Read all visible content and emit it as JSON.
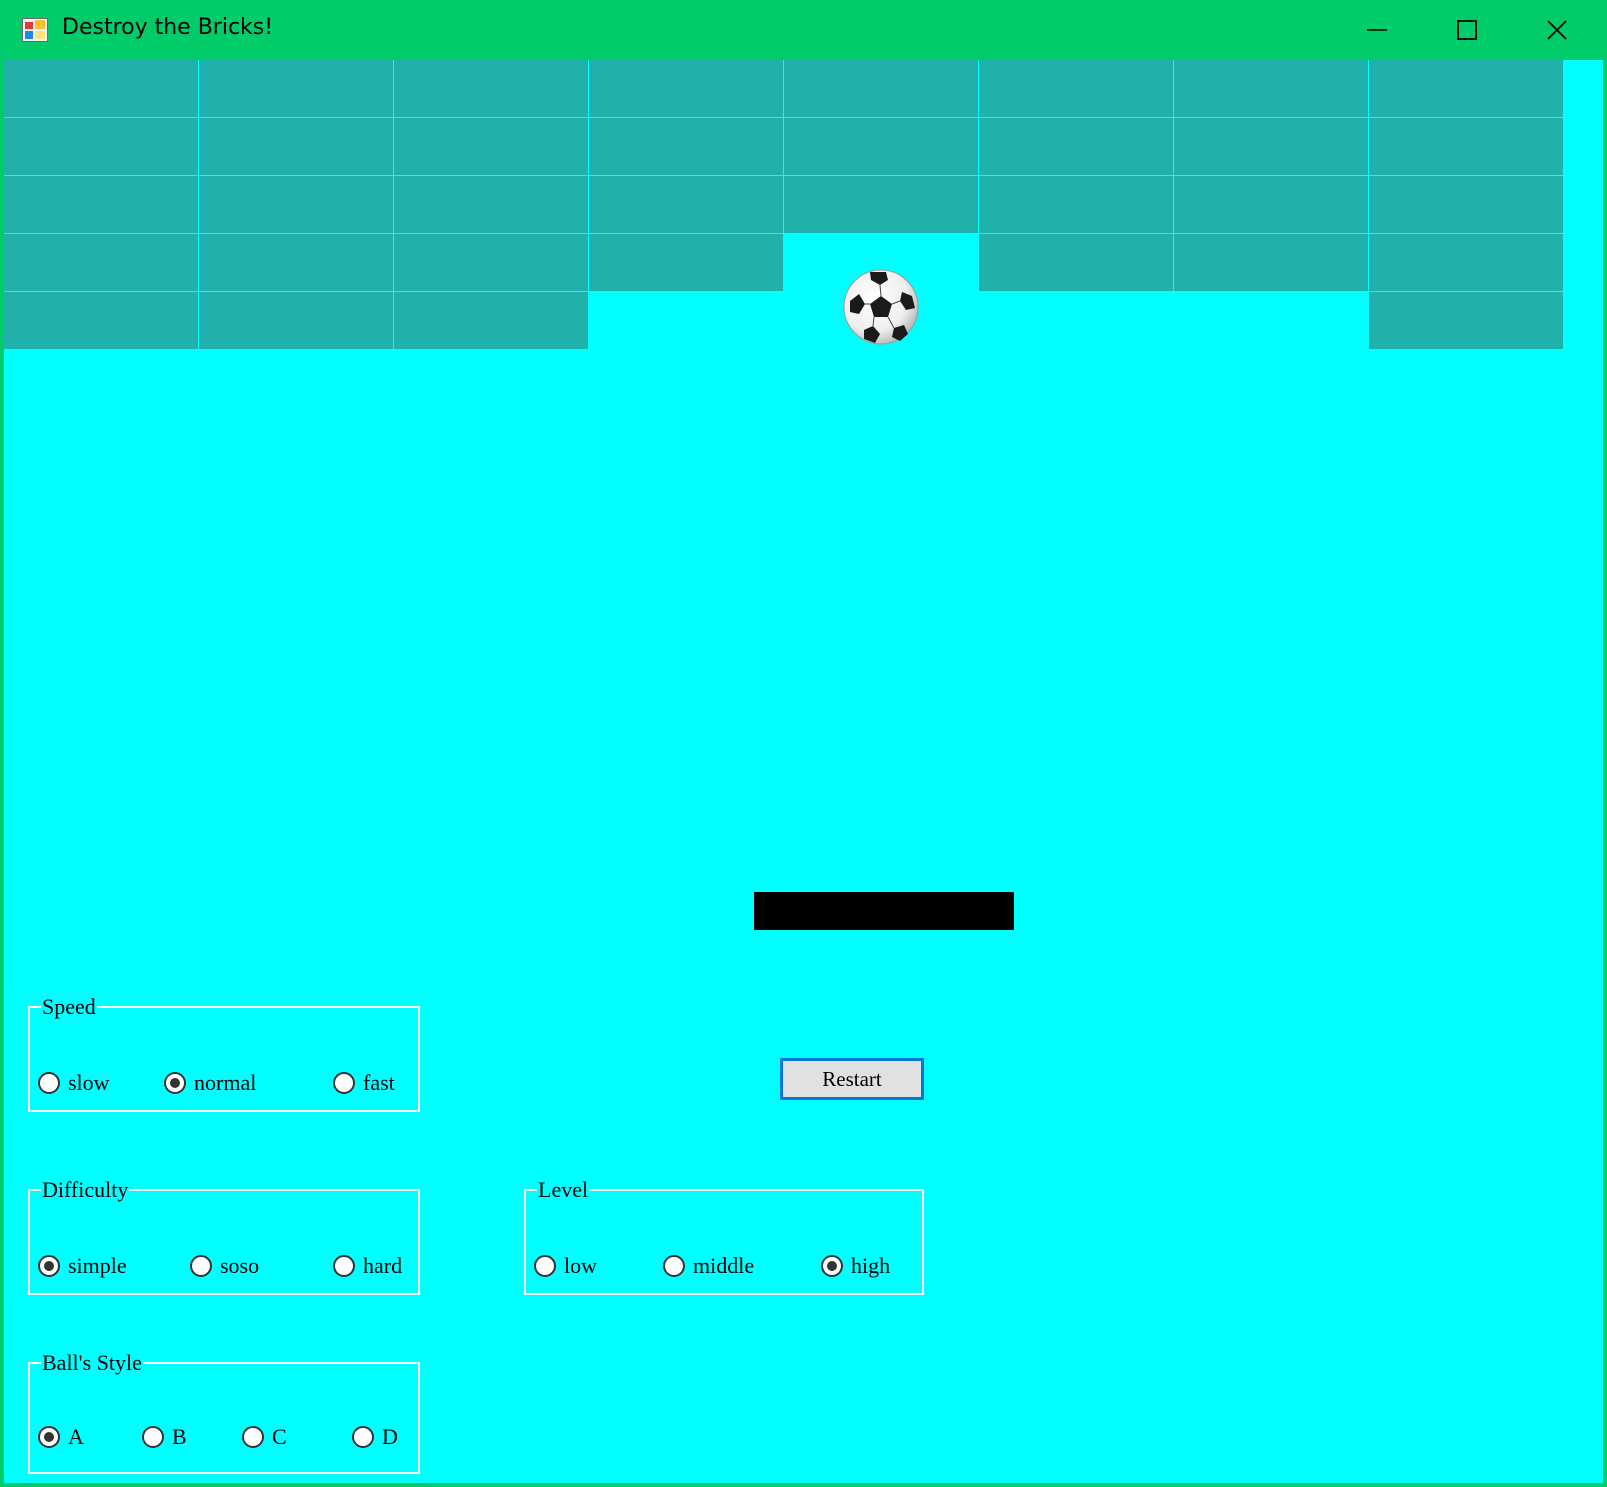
{
  "window": {
    "title": "Destroy the Bricks!",
    "controls": [
      "minimize",
      "maximize",
      "close"
    ]
  },
  "game": {
    "bricks": {
      "columns": 8,
      "rows": 5,
      "present": [
        [
          1,
          1,
          1,
          1,
          1,
          1,
          1,
          1
        ],
        [
          1,
          1,
          1,
          1,
          1,
          1,
          1,
          1
        ],
        [
          1,
          1,
          1,
          1,
          1,
          1,
          1,
          1
        ],
        [
          1,
          1,
          1,
          1,
          0,
          1,
          1,
          1
        ],
        [
          1,
          1,
          1,
          0,
          0,
          0,
          0,
          1
        ]
      ]
    },
    "colors": {
      "background": "#00ffff",
      "brick": "#20b2aa",
      "paddle": "#000000",
      "titlebar": "#00cc6a"
    },
    "ball_icon": "soccer-ball-icon",
    "restart_label": "Restart"
  },
  "options": {
    "speed": {
      "legend": "Speed",
      "items": [
        {
          "label": "slow",
          "checked": false
        },
        {
          "label": "normal",
          "checked": true
        },
        {
          "label": "fast",
          "checked": false
        }
      ]
    },
    "difficulty": {
      "legend": "Difficulty",
      "items": [
        {
          "label": "simple",
          "checked": true
        },
        {
          "label": "soso",
          "checked": false
        },
        {
          "label": "hard",
          "checked": false
        }
      ]
    },
    "level": {
      "legend": "Level",
      "items": [
        {
          "label": "low",
          "checked": false
        },
        {
          "label": "middle",
          "checked": false
        },
        {
          "label": "high",
          "checked": true
        }
      ]
    },
    "ball_style": {
      "legend": "Ball's Style",
      "items": [
        {
          "label": "A",
          "checked": true
        },
        {
          "label": "B",
          "checked": false
        },
        {
          "label": "C",
          "checked": false
        },
        {
          "label": "D",
          "checked": false
        }
      ]
    }
  }
}
